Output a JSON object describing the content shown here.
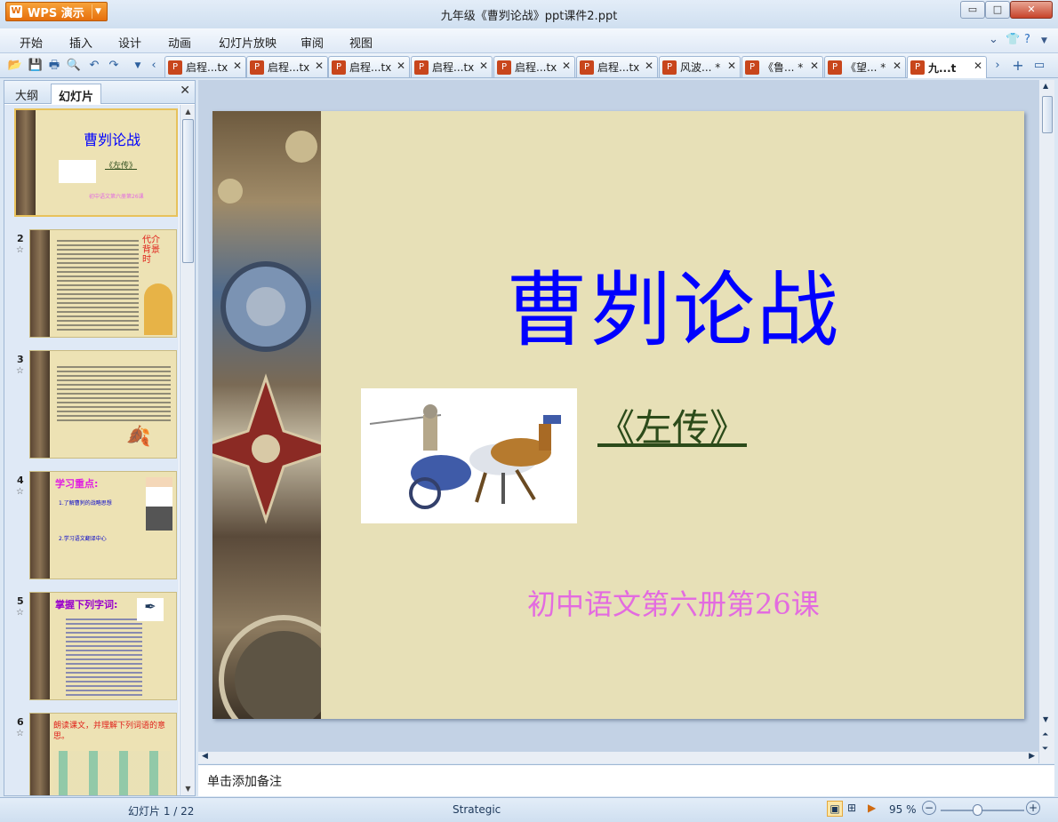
{
  "app": {
    "brand": "WPS 演示",
    "window_title": "九年级《曹刿论战》ppt课件2.ppt"
  },
  "window_controls": {
    "minimize": "▭",
    "maximize": "□",
    "close": "✕"
  },
  "menu": [
    "开始",
    "插入",
    "设计",
    "动画",
    "幻灯片放映",
    "审阅",
    "视图"
  ],
  "doc_tabs": [
    {
      "label": "启程...tx",
      "active": false
    },
    {
      "label": "启程...tx",
      "active": false
    },
    {
      "label": "启程...tx",
      "active": false
    },
    {
      "label": "启程...tx",
      "active": false
    },
    {
      "label": "启程...tx",
      "active": false
    },
    {
      "label": "启程...tx",
      "active": false
    },
    {
      "label": "风波... *",
      "active": false
    },
    {
      "label": "《鲁... *",
      "active": false
    },
    {
      "label": "《望... *",
      "active": false
    },
    {
      "label": "九...t",
      "active": true
    }
  ],
  "left_pane": {
    "tabs": [
      "大纲",
      "幻灯片"
    ],
    "active_tab": "幻灯片",
    "thumbnails": [
      {
        "num": "1",
        "title": "曹刿论战",
        "line2": "《左传》",
        "line3": "初中语文第六册第26课"
      },
      {
        "num": "2",
        "title": "代介背景时",
        "line2": "",
        "line3": ""
      },
      {
        "num": "3",
        "title": "",
        "line2": "",
        "line3": ""
      },
      {
        "num": "4",
        "title": "学习重点:",
        "line2": "1.了解曹刿的战略思想",
        "line3": "2.学习语文翻译中心"
      },
      {
        "num": "5",
        "title": "掌握下列字词:",
        "line2": "",
        "line3": ""
      },
      {
        "num": "6",
        "title": "朗读课文，并理解下列词语的意思。",
        "line2": "",
        "line3": ""
      }
    ]
  },
  "slide": {
    "title": "曹刿论战",
    "subtitle": "《左传》",
    "footer": "初中语文第六册第26课"
  },
  "notes_placeholder": "单击添加备注",
  "status": {
    "slide_counter": "幻灯片 1 / 22",
    "theme": "Strategic",
    "zoom": "95 %"
  },
  "colors": {
    "title": "#0000ff",
    "subtitle": "#2c4b1a",
    "footer": "#e36be0",
    "slide_bg": "#e7e0b7",
    "brand": "#e66f0c"
  }
}
